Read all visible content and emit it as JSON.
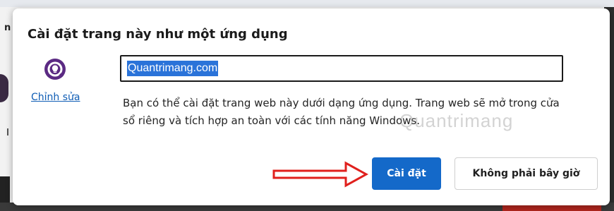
{
  "dialog": {
    "title": "Cài đặt trang này như một ứng dụng",
    "edit_link": "Chỉnh sửa",
    "app_name_value": "Quantrimang.com",
    "description": "Bạn có thể cài đặt trang web này dưới dạng ứng dụng. Trang web sẽ mở trong cửa sổ riêng và tích hợp an toàn với các tính năng Windows.",
    "install_button": "Cài đặt",
    "not_now_button": "Không phải bây giờ",
    "app_icon": "quantrimang-logo-icon"
  },
  "background": {
    "left_letter": "n"
  },
  "annotation": {
    "arrow_icon": "red-arrow-right-icon",
    "watermark": "Quantrimang"
  },
  "colors": {
    "primary_button": "#1469c9",
    "link": "#0f5db5",
    "selection": "#2a73d9",
    "arrow": "#e0201d",
    "logo_purple": "#5b2a83"
  }
}
